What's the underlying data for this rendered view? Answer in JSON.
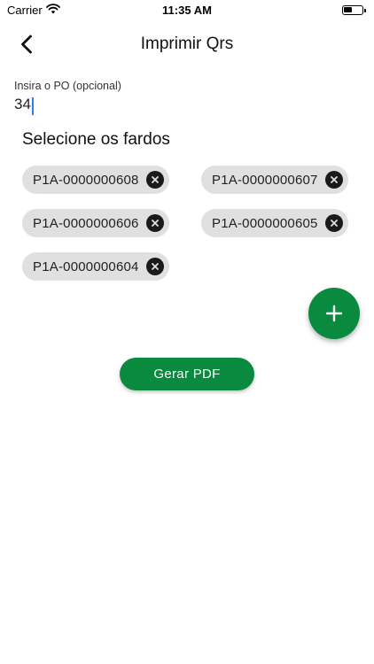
{
  "status_bar": {
    "carrier": "Carrier",
    "time": "11:35 AM",
    "battery_level": 0.45,
    "icons": [
      "wifi-icon",
      "battery-icon"
    ]
  },
  "header": {
    "title": "Imprimir Qrs",
    "back_icon": "chevron-left-icon"
  },
  "po_field": {
    "label": "Insira o PO (opcional)",
    "value": "34"
  },
  "section_title": "Selecione os fardos",
  "chips": [
    {
      "label": "P1A-0000000608",
      "remove_icon": "close-circle-icon"
    },
    {
      "label": "P1A-0000000607",
      "remove_icon": "close-circle-icon"
    },
    {
      "label": "P1A-0000000606",
      "remove_icon": "close-circle-icon"
    },
    {
      "label": "P1A-0000000605",
      "remove_icon": "close-circle-icon"
    },
    {
      "label": "P1A-0000000604",
      "remove_icon": "close-circle-icon"
    }
  ],
  "fab": {
    "icon": "plus-icon"
  },
  "pdf_button": {
    "label": "Gerar PDF"
  },
  "colors": {
    "accent": "#0a8a3e",
    "chip_background": "#e0e0e0",
    "caret": "#2d7ff9"
  }
}
